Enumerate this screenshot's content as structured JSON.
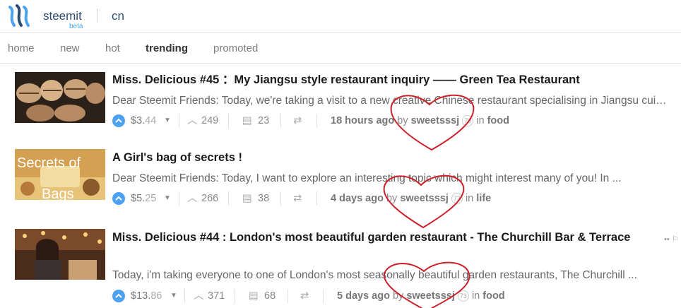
{
  "header": {
    "brand": "steemit",
    "beta": "beta",
    "channel": "cn"
  },
  "nav": {
    "tabs": [
      {
        "label": "home"
      },
      {
        "label": "new"
      },
      {
        "label": "hot"
      },
      {
        "label": "trending",
        "active": true
      },
      {
        "label": "promoted"
      }
    ]
  },
  "posts": [
    {
      "title": "Miss. Delicious #45 ：My Jiangsu style restaurant inquiry —— Green Tea Restaurant",
      "excerpt": "Dear Steemit Friends: Today, we're taking a visit to a new creative Chinese restaurant specialising in Jiangsu cuisine...",
      "payout_main": "$3.",
      "payout_cents": "44",
      "votes": "249",
      "comments": "23",
      "time": "18 hours ago",
      "by": "by",
      "author": "sweetsssj",
      "reputation": "73",
      "in": "in",
      "category": "food"
    },
    {
      "title": "A Girl's bag of secrets !",
      "excerpt": "Dear Steemit Friends: Today, I want to explore an interesting topic which might interest many of you! In ...",
      "payout_main": "$5.",
      "payout_cents": "25",
      "votes": "266",
      "comments": "38",
      "time": "4 days ago",
      "by": "by",
      "author": "sweetsssj",
      "reputation": "73",
      "in": "in",
      "category": "life",
      "thumb_text": [
        "Secrets of",
        "Bags"
      ]
    },
    {
      "title": "Miss. Delicious #44 : London's most beautiful garden restaurant - The Churchill Bar & Terrace",
      "excerpt": "Today, i'm taking everyone to one of London's most seasonally beautiful garden restaurants, The Churchill ...",
      "payout_main": "$13.",
      "payout_cents": "86",
      "votes": "371",
      "comments": "68",
      "time": "5 days ago",
      "by": "by",
      "author": "sweetsssj",
      "reputation": "73",
      "in": "in",
      "category": "food"
    }
  ],
  "icons": {
    "upvote": "upvote-icon",
    "chevron_up": "chevron-up-icon",
    "comments": "comments-icon",
    "reblog": "reblog-icon",
    "caret": "caret-down-icon"
  },
  "colors": {
    "accent": "#4ba2f2",
    "brand": "#2c4c74",
    "heart": "#cc1f2a"
  }
}
